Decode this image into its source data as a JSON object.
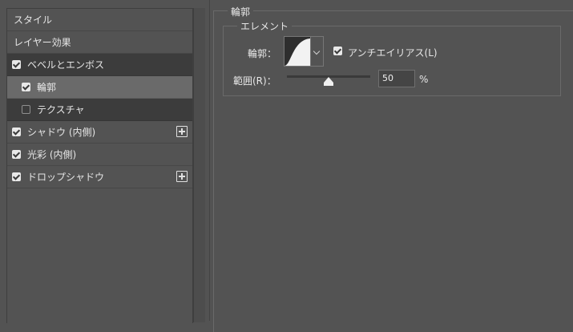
{
  "left": {
    "header_styles": "スタイル",
    "header_layer_effects": "レイヤー効果",
    "items": [
      {
        "label": "ベベルとエンボス",
        "checked": true
      },
      {
        "label": "輪郭",
        "checked": true
      },
      {
        "label": "テクスチャ",
        "checked": false
      },
      {
        "label": "シャドウ (内側)",
        "checked": true
      },
      {
        "label": "光彩 (内側)",
        "checked": true
      },
      {
        "label": "ドロップシャドウ",
        "checked": true
      }
    ]
  },
  "right": {
    "section_title": "輪郭",
    "group_title": "エレメント",
    "contour_label": "輪郭：",
    "antialias_label": "アンチエイリアス(L)",
    "antialias_checked": true,
    "range_label": "範囲(R)：",
    "range_value": "50",
    "range_unit": "%",
    "range_fraction": 0.5
  },
  "colors": {
    "panel_bg": "#535353",
    "row_dark": "#3c3c3c",
    "row_selected": "#6a6a6a",
    "text": "#e6e6e6"
  }
}
